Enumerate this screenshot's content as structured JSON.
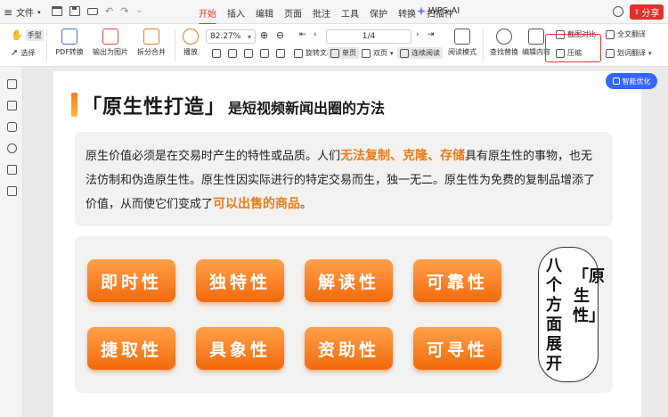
{
  "titlebar": {
    "file_menu": "文件",
    "menu_items": [
      "开始",
      "插入",
      "编辑",
      "页面",
      "批注",
      "工具",
      "保护",
      "转换",
      "扫描件"
    ],
    "active_menu": "开始",
    "wps_ai": "WPS AI",
    "share": "分享"
  },
  "toolbar": {
    "hand": "手型",
    "select": "选择",
    "pdf_convert": "PDF转换",
    "export_image": "输出为图片",
    "split_merge": "拆分合并",
    "play": "播放",
    "zoom_value": "82.27%",
    "page_value": "1/4",
    "rotate": "旋转文档",
    "single_page": "单页",
    "double_page": "双页",
    "continuous": "连续阅读",
    "reading_mode": "阅读模式",
    "find_replace": "查找替换",
    "edit_content": "编辑内容",
    "screenshot_compare": "截图对比",
    "compress": "压缩",
    "full_translate": "全文翻译",
    "word_translate": "划词翻译"
  },
  "ai_badge": "智能优化",
  "document": {
    "title_main": "「原生性打造」",
    "title_sub": "是短视频新闻出圈的方法",
    "para_parts": [
      "原生价值必须是在交易时产生的特性或品质。人们",
      "无法复制、克隆、存储",
      "具有原生性的事物，也无法仿制和伪造原生性。原生性因实际进行的特定交易而生，独一无二。原生性为免费的复制品增添了价值，从而使它们变成了",
      "可以出售的商品",
      "。"
    ],
    "traits": [
      "即时性",
      "独特性",
      "解读性",
      "可靠性",
      "捷取性",
      "具象性",
      "资助性",
      "可寻性"
    ],
    "vertical_left": "八个方面展开",
    "vertical_right": "「原生性」"
  },
  "colors": {
    "accent_red": "#e0312b",
    "highlight_orange": "#f07b18",
    "ai_blue": "#3366ff"
  }
}
